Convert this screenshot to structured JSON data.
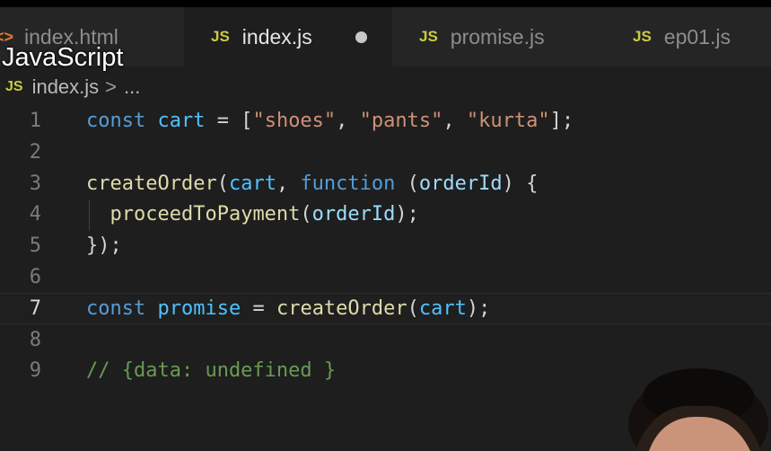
{
  "tabs": [
    {
      "name": "index.html",
      "icon": "html-file-icon",
      "active": false
    },
    {
      "name": "index.js",
      "icon": "js-file-icon",
      "active": true,
      "modified": true
    },
    {
      "name": "promise.js",
      "icon": "js-file-icon",
      "active": false
    },
    {
      "name": "ep01.js",
      "icon": "js-file-icon",
      "active": false
    }
  ],
  "tab_icons": {
    "js": "JS",
    "html": "<>"
  },
  "overlay_caption": "JavaScript",
  "breadcrumb": {
    "file": "index.js",
    "separator": ">",
    "more": "..."
  },
  "editor": {
    "current_line": 7,
    "lines": [
      {
        "number": "1",
        "tokens": [
          [
            "kw",
            "const "
          ],
          [
            "var",
            "cart"
          ],
          [
            "pun",
            " = ["
          ],
          [
            "str",
            "\"shoes\""
          ],
          [
            "pun",
            ", "
          ],
          [
            "str",
            "\"pants\""
          ],
          [
            "pun",
            ", "
          ],
          [
            "str",
            "\"kurta\""
          ],
          [
            "pun",
            "];"
          ]
        ]
      },
      {
        "number": "2",
        "tokens": []
      },
      {
        "number": "3",
        "tokens": [
          [
            "fn",
            "createOrder"
          ],
          [
            "pun",
            "("
          ],
          [
            "var",
            "cart"
          ],
          [
            "pun",
            ", "
          ],
          [
            "kw",
            "function "
          ],
          [
            "pun",
            "("
          ],
          [
            "param",
            "orderId"
          ],
          [
            "pun",
            ") {"
          ]
        ]
      },
      {
        "number": "4",
        "tokens": [
          [
            "pun",
            "  "
          ],
          [
            "fn",
            "proceedToPayment"
          ],
          [
            "pun",
            "("
          ],
          [
            "param",
            "orderId"
          ],
          [
            "pun",
            ");"
          ]
        ]
      },
      {
        "number": "5",
        "tokens": [
          [
            "pun",
            "});"
          ]
        ]
      },
      {
        "number": "6",
        "tokens": []
      },
      {
        "number": "7",
        "tokens": [
          [
            "kw",
            "const "
          ],
          [
            "var",
            "promise"
          ],
          [
            "pun",
            " = "
          ],
          [
            "fn",
            "createOrder"
          ],
          [
            "pun",
            "("
          ],
          [
            "var",
            "cart"
          ],
          [
            "pun",
            ");"
          ]
        ]
      },
      {
        "number": "8",
        "tokens": []
      },
      {
        "number": "9",
        "tokens": [
          [
            "cmt",
            "// {data: undefined }"
          ]
        ]
      }
    ]
  },
  "colors": {
    "editor_bg": "#1e1e1e",
    "tabbar_bg": "#252526",
    "keyword": "#569cd6",
    "variable": "#4fc1ff",
    "parameter": "#9cdcfe",
    "function": "#dcdcaa",
    "string": "#ce9178",
    "comment": "#6a9955",
    "js_icon": "#cbcb41"
  }
}
